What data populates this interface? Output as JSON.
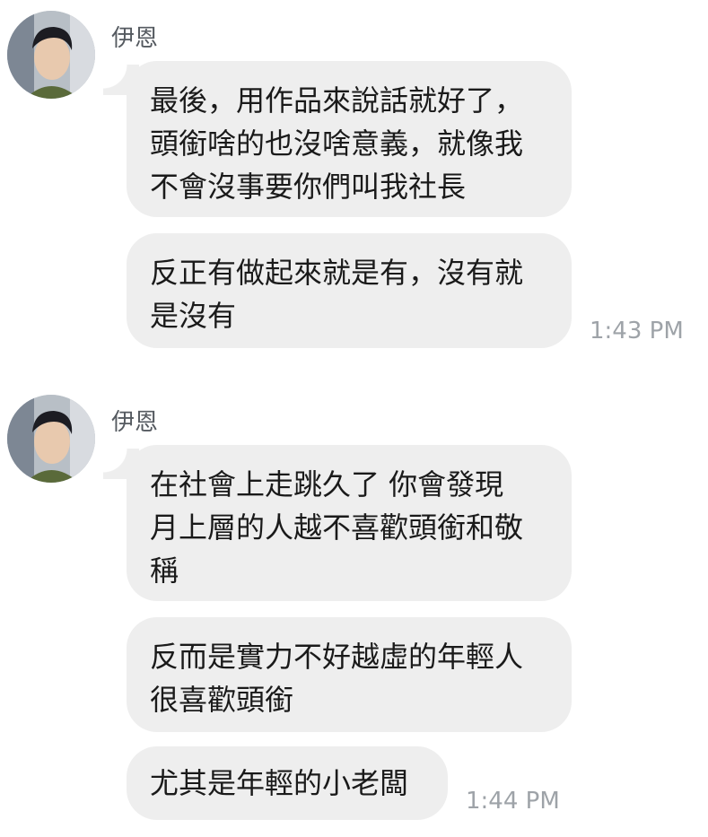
{
  "groups": [
    {
      "sender": "伊恩",
      "messages": [
        "最後，用作品來說話就好了，\n頭銜啥的也沒啥意義，就像我\n不會沒事要你們叫我社長",
        "反正有做起來就是有，沒有就\n是沒有"
      ],
      "time": "1:43 PM"
    },
    {
      "sender": "伊恩",
      "messages": [
        "在社會上走跳久了 你會發現\n月上層的人越不喜歡頭銜和敬\n稱",
        "反而是實力不好越虛的年輕人\n很喜歡頭銜",
        "尤其是年輕的小老闆"
      ],
      "time": "1:44 PM"
    }
  ],
  "colors": {
    "bubble": "#eeeeee",
    "time": "#9ea3a8",
    "sender": "#555a60"
  }
}
